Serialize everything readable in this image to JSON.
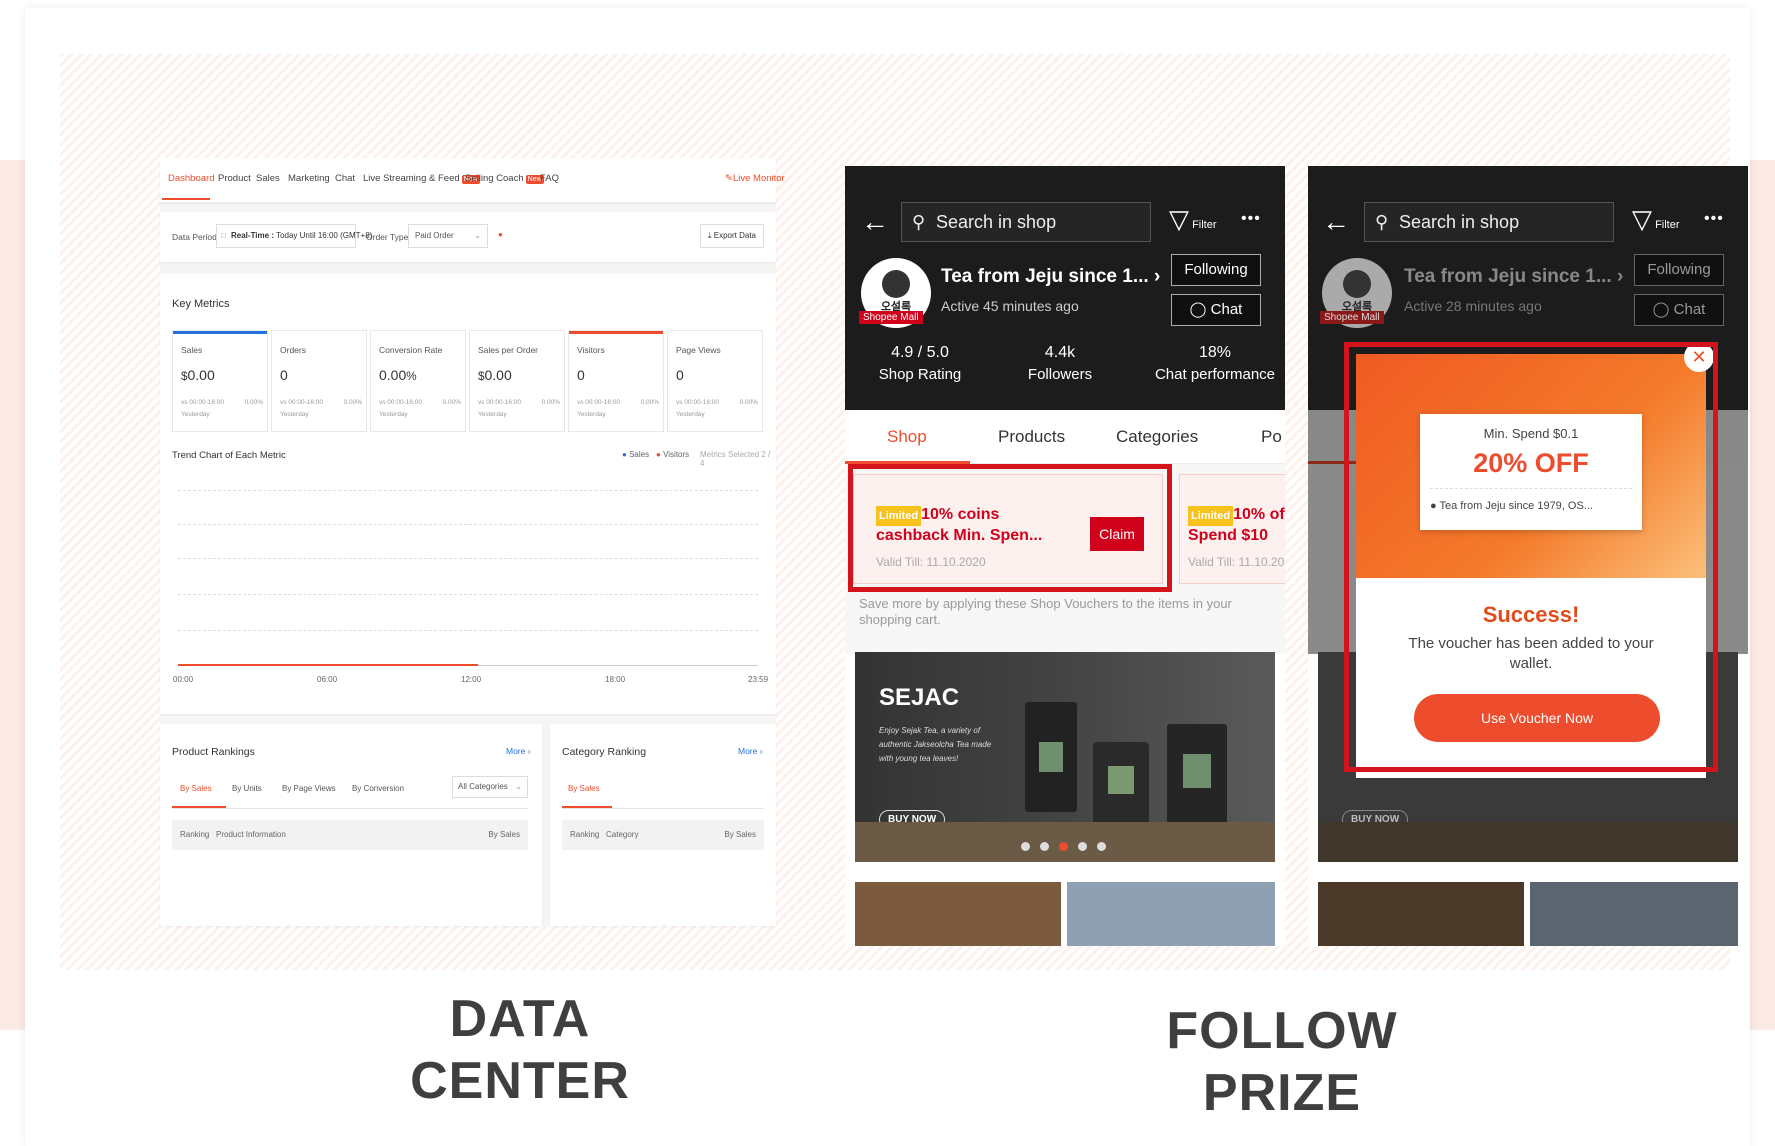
{
  "captions": {
    "left_line1": "DATA",
    "left_line2": "CENTER",
    "right_line1": "FOLLOW",
    "right_line2": "PRIZE"
  },
  "dashboard": {
    "tabs": [
      "Dashboard",
      "Product",
      "Sales",
      "Marketing",
      "Chat",
      "Live Streaming & Feed",
      "Selling Coach",
      "FAQ"
    ],
    "new_badge": "New",
    "live_monitor": "Live Monitor",
    "data_period_label": "Data Period",
    "realtime_label": "Real-Time :",
    "realtime_value": "Today Until 16:00 (GMT+8)",
    "order_type_label": "Order Type",
    "order_type_value": "Paid Order",
    "export_label": "Export Data",
    "key_metrics_title": "Key Metrics",
    "metrics": [
      {
        "name": "Sales",
        "value": "0.00",
        "currency": "$",
        "compare": "vs 00:00-16:00",
        "yesterday": "Yesterday",
        "pct": "0.00%"
      },
      {
        "name": "Orders",
        "value": "0",
        "currency": "",
        "compare": "vs 00:00-16:00",
        "yesterday": "Yesterday",
        "pct": "0.00%"
      },
      {
        "name": "Conversion Rate",
        "value": "0.00",
        "currency": "",
        "suffix": "%",
        "compare": "vs 00:00-16:00",
        "yesterday": "Yesterday",
        "pct": "0.00%"
      },
      {
        "name": "Sales per Order",
        "value": "0.00",
        "currency": "$",
        "compare": "vs 00:00-16:00",
        "yesterday": "Yesterday",
        "pct": "0.00%"
      },
      {
        "name": "Visitors",
        "value": "0",
        "currency": "",
        "compare": "vs 00:00-16:00",
        "yesterday": "Yesterday",
        "pct": "0.00%"
      },
      {
        "name": "Page Views",
        "value": "0",
        "currency": "",
        "compare": "vs 00:00-16:00",
        "yesterday": "Yesterday",
        "pct": "0.00%"
      }
    ],
    "trend_title": "Trend Chart of Each Metric",
    "legend_sales": "Sales",
    "legend_visitors": "Visitors",
    "metrics_selected": "Metrics Selected 2 / 4",
    "x_ticks": [
      "00:00",
      "06:00",
      "12:00",
      "18:00",
      "23:59"
    ],
    "product_rankings": {
      "title": "Product Rankings",
      "more": "More",
      "tabs": [
        "By Sales",
        "By Units",
        "By Page Views",
        "By Conversion"
      ],
      "category_select": "All Categories",
      "headers": [
        "Ranking",
        "Product Information",
        "By Sales"
      ]
    },
    "category_ranking": {
      "title": "Category Ranking",
      "more": "More",
      "tabs": [
        "By Sales"
      ],
      "headers": [
        "Ranking",
        "Category",
        "By Sales"
      ]
    },
    "colors": {
      "accent": "#ee4d2d",
      "sales_blue": "#2673dd"
    }
  },
  "phone1": {
    "search_placeholder": "Search in shop",
    "filter": "Filter",
    "shop_name": "Tea from Jeju since 1...",
    "active": "Active 45 minutes ago",
    "following": "Following",
    "chat": "Chat",
    "mall_badge": "Shopee Mall",
    "logo_text": "오설록",
    "stats": [
      {
        "value": "4.9 / 5.0",
        "label": "Shop Rating"
      },
      {
        "value": "4.4k",
        "label": "Followers"
      },
      {
        "value": "18%",
        "label": "Chat performance"
      }
    ],
    "tabs": [
      "Shop",
      "Products",
      "Categories",
      "Po"
    ],
    "voucher1": {
      "limited": "Limited",
      "line1": "10% coins",
      "line2": "cashback Min. Spen...",
      "valid": "Valid Till: 11.10.2020",
      "claim": "Claim"
    },
    "voucher2": {
      "limited": "Limited",
      "line1": "10% of",
      "line2": "Spend $10",
      "valid": "Valid Till: 11.10.20"
    },
    "voucher_note": "Save more by applying these Shop Vouchers to the items in your shopping cart.",
    "banner": {
      "brand": "SEJAC",
      "desc": "Enjoy Sejak Tea, a variety of authentic Jakseolcha Tea made with young tea leaves!",
      "cta": "BUY NOW"
    }
  },
  "phone2": {
    "search_placeholder": "Search in shop",
    "filter": "Filter",
    "shop_name": "Tea from Jeju since 1...",
    "active": "Active 28 minutes ago",
    "following": "Following",
    "chat": "Chat",
    "mall_badge": "Shopee Mall",
    "logo_text": "오설록",
    "modal": {
      "min_spend": "Min. Spend $0.1",
      "discount": "20% OFF",
      "shop": "Tea from Jeju since 1979, OS...",
      "success": "Success!",
      "message": "The voucher has been added to your wallet.",
      "cta": "Use Voucher Now"
    },
    "banner_cta": "BUY NOW"
  }
}
